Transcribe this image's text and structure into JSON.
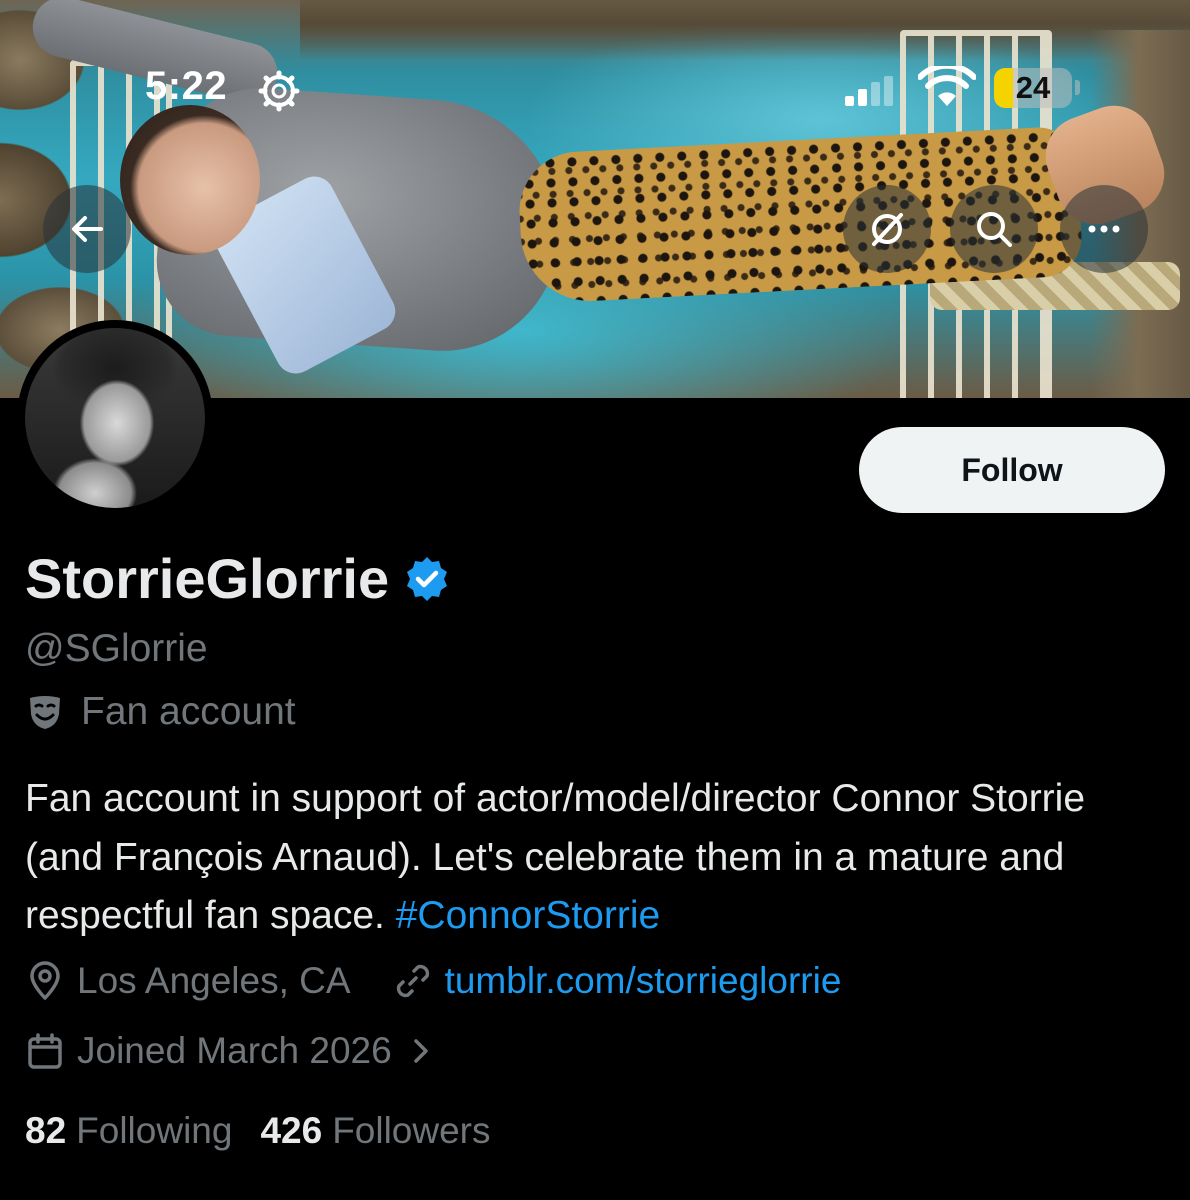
{
  "status_bar": {
    "time": "5:22",
    "battery": "24",
    "battery_level_percent": 24
  },
  "header": {
    "back_icon": "arrow-left-icon",
    "grok_icon": "grok-icon",
    "search_icon": "search-icon",
    "more_icon": "more-horizontal-icon"
  },
  "profile": {
    "display_name": "StorrieGlorrie",
    "handle": "@SGlorrie",
    "category": "Fan account",
    "bio_text": "Fan account in support of actor/model/director Connor Storrie (and François Arnaud). Let's celebrate them in a mature and respectful fan space. ",
    "bio_hashtag": "#ConnorStorrie",
    "location": "Los Angeles, CA",
    "website": "tumblr.com/storrieglorrie",
    "joined": "Joined March 2026",
    "following_count": "82",
    "following_label": "Following",
    "followers_count": "426",
    "followers_label": "Followers"
  },
  "actions": {
    "follow_label": "Follow"
  },
  "colors": {
    "background": "#000000",
    "primary_text": "#e7e9ea",
    "secondary_text": "#71767b",
    "link": "#1d9bf0",
    "verified_badge": "#1d9bf0",
    "follow_button": "#eff3f4"
  }
}
